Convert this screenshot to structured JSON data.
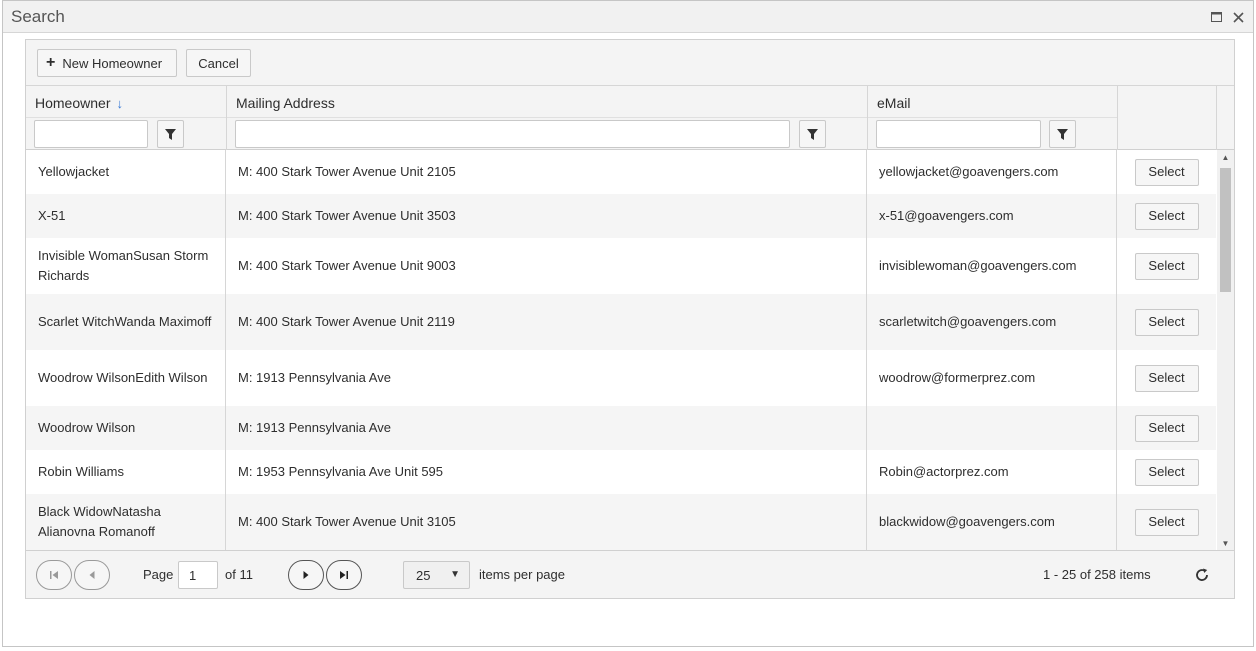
{
  "window": {
    "title": "Search"
  },
  "toolbar": {
    "new_label": "New Homeowner",
    "cancel_label": "Cancel"
  },
  "columns": {
    "homeowner": "Homeowner",
    "mailing": "Mailing Address",
    "email": "eMail"
  },
  "rows": [
    {
      "name": "Yellowjacket",
      "address": "M: 400 Stark Tower Avenue Unit 2105",
      "email": "yellowjacket@goavengers.com",
      "action": "Select"
    },
    {
      "name": "X-51",
      "address": "M: 400 Stark Tower Avenue Unit 3503",
      "email": "x-51@goavengers.com",
      "action": "Select"
    },
    {
      "name": "Invisible WomanSusan Storm Richards",
      "address": "M: 400 Stark Tower Avenue Unit 9003",
      "email": "invisiblewoman@goavengers.com",
      "action": "Select"
    },
    {
      "name": "Scarlet WitchWanda Maximoff",
      "address": "M: 400 Stark Tower Avenue Unit 2119",
      "email": "scarletwitch@goavengers.com",
      "action": "Select"
    },
    {
      "name": "Woodrow WilsonEdith Wilson",
      "address": "M: 1913 Pennsylvania Ave",
      "email": "woodrow@formerprez.com",
      "action": "Select"
    },
    {
      "name": "Woodrow Wilson",
      "address": "M: 1913 Pennsylvania Ave",
      "email": "",
      "action": "Select"
    },
    {
      "name": "Robin Williams",
      "address": "M: 1953 Pennsylvania Ave Unit 595",
      "email": "Robin@actorprez.com",
      "action": "Select"
    },
    {
      "name": "Black WidowNatasha Alianovna Romanoff",
      "address": "M: 400 Stark Tower Avenue Unit 3105",
      "email": "blackwidow@goavengers.com",
      "action": "Select"
    }
  ],
  "pager": {
    "page_label": "Page",
    "page": "1",
    "of_label": "of 11",
    "page_size": "25",
    "items_per_page_label": "items per page",
    "info": "1 - 25 of 258 items"
  },
  "icons": {
    "plus": "plus-icon",
    "filter": "filter-icon",
    "sort": "sort-descending-icon",
    "first": "first-page-icon",
    "prev": "previous-page-icon",
    "next": "next-page-icon",
    "last": "last-page-icon",
    "refresh": "refresh-icon"
  }
}
